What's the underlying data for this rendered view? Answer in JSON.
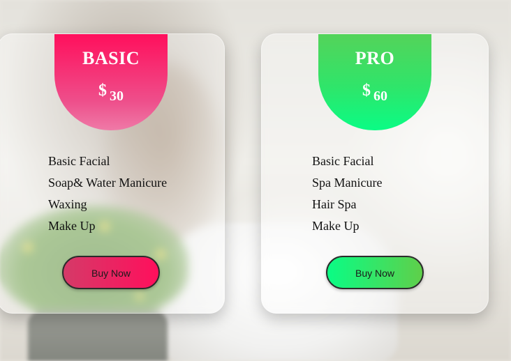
{
  "plans": [
    {
      "name": "BASIC",
      "currency": "$",
      "price": "30",
      "features": [
        "Basic Facial",
        "Soap& Water Manicure",
        "Waxing",
        "Make Up"
      ],
      "button_label": "Buy Now",
      "accent_colors": [
        "#ff0f5c",
        "#ef7aa7"
      ]
    },
    {
      "name": "PRO",
      "currency": "$",
      "price": "60",
      "features": [
        "Basic Facial",
        "Spa Manicure",
        "Hair Spa",
        "Make Up"
      ],
      "button_label": "Buy Now",
      "accent_colors": [
        "#54d35a",
        "#0afc85"
      ]
    }
  ]
}
